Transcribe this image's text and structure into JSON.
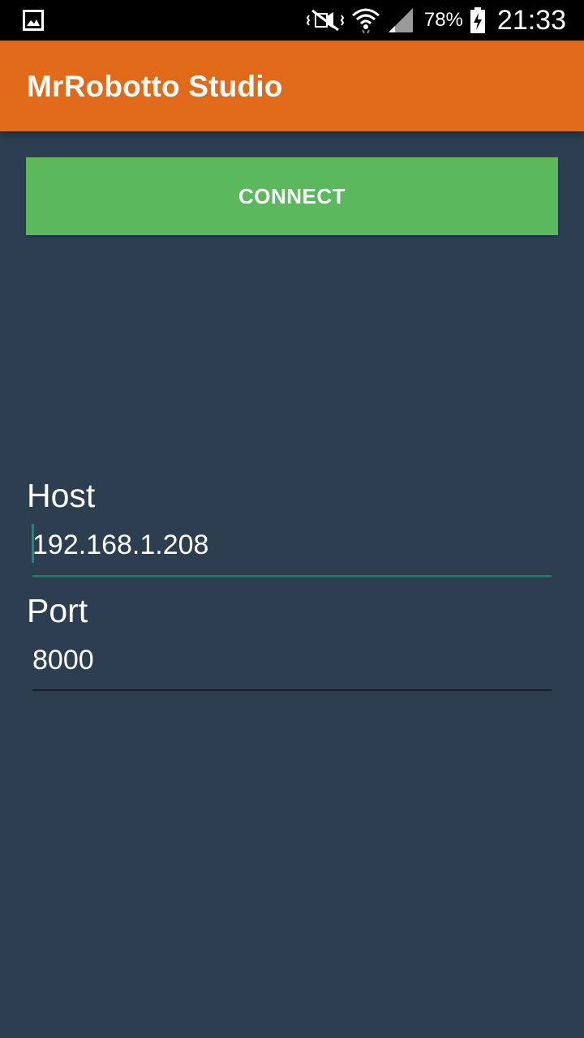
{
  "status_bar": {
    "battery_percent": "78%",
    "time": "21:33",
    "icons": [
      "gallery-notification-icon",
      "mute-vibrate-icon",
      "wifi-icon",
      "signal-icon",
      "battery-charging-icon"
    ]
  },
  "app_bar": {
    "title": "MrRobotto Studio",
    "color": "#e0691a"
  },
  "connect_button": {
    "label": "CONNECT",
    "color": "#5cb85c"
  },
  "form": {
    "host": {
      "label": "Host",
      "value": "192.168.1.208"
    },
    "port": {
      "label": "Port",
      "value": "8000"
    }
  },
  "colors": {
    "background": "#2c3e50",
    "accent": "#1a7a6e"
  }
}
